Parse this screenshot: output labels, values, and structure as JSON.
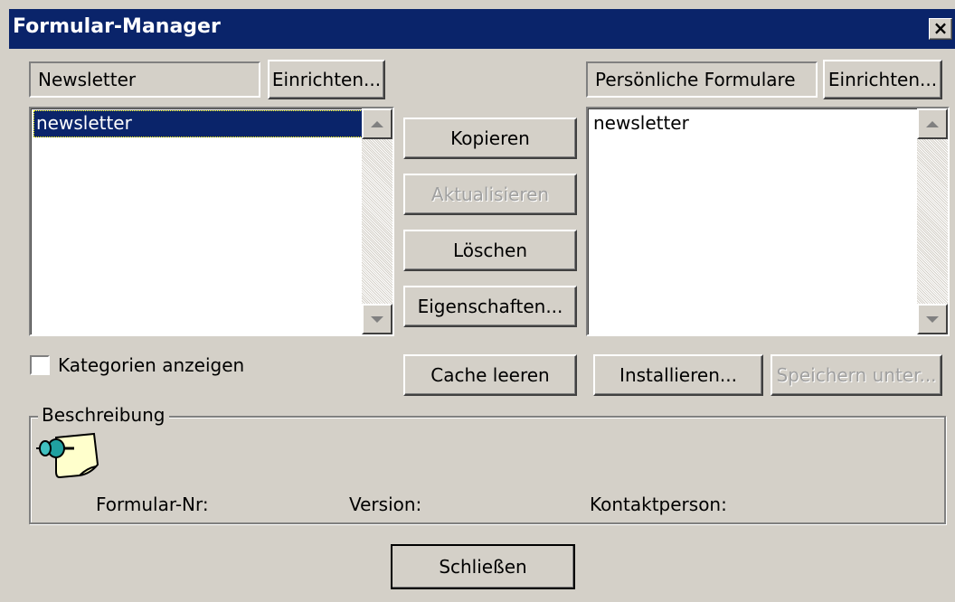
{
  "window": {
    "title": "Formular-Manager",
    "close_label": "×"
  },
  "left": {
    "library_name": "Newsletter",
    "setup_label": "Einrichten...",
    "items": [
      "newsletter"
    ],
    "show_categories_label": "Kategorien anzeigen",
    "show_categories_checked": false
  },
  "middle": {
    "copy_label": "Kopieren",
    "update_label": "Aktualisieren",
    "delete_label": "Löschen",
    "properties_label": "Eigenschaften...",
    "clear_cache_label": "Cache leeren"
  },
  "right": {
    "library_name": "Persönliche Formulare",
    "setup_label": "Einrichten...",
    "items": [
      "newsletter"
    ],
    "install_label": "Installieren...",
    "save_as_label": "Speichern unter..."
  },
  "description": {
    "legend": "Beschreibung",
    "icon": "form-pushpin-icon",
    "form_nr_label": "Formular-Nr:",
    "version_label": "Version:",
    "contact_label": "Kontaktperson:"
  },
  "footer": {
    "close_label": "Schließen"
  },
  "colors": {
    "titlebar": "#0a246a",
    "face": "#d4d0c8",
    "selection": "#0a246a"
  }
}
